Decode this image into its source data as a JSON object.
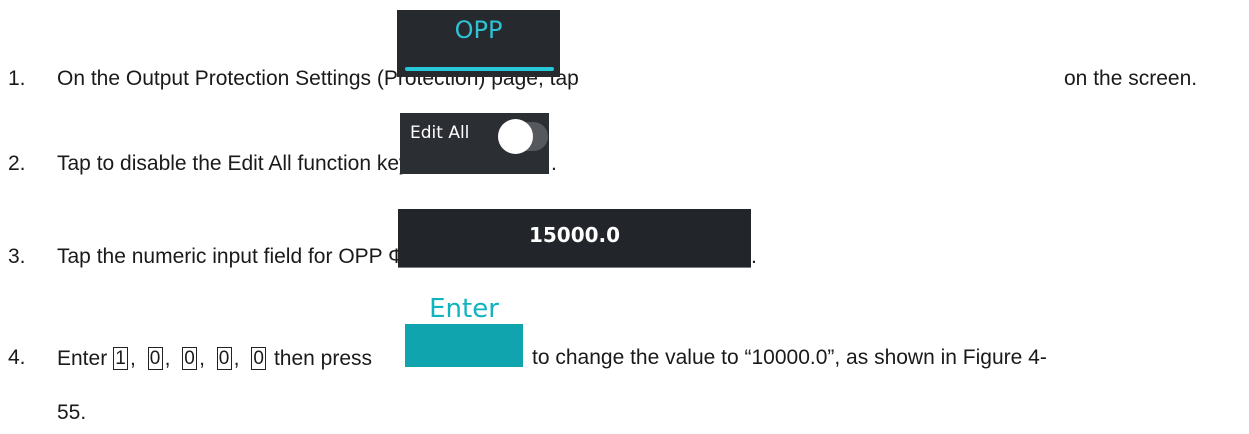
{
  "steps": [
    {
      "num": "1.",
      "before": "On the Output Protection Settings (Protection) page, tap",
      "after": "on the screen."
    },
    {
      "num": "2.",
      "before": "Tap to disable the Edit All function key",
      "after": "."
    },
    {
      "num": "3.",
      "before": "Tap the numeric input field for OPP Φ1",
      "after": "."
    },
    {
      "num": "4.",
      "before": "Enter",
      "keys": [
        "1",
        "0",
        "0",
        "0",
        "0"
      ],
      "key_sep": ",",
      "middle": "then press",
      "after": "to change the value to “10000.0”, as shown in Figure 4-",
      "continuation": "55."
    }
  ],
  "images": {
    "opp_tab": {
      "label": "OPP",
      "bg": "#262a2e",
      "accent": "#27c7d9"
    },
    "edit_all": {
      "label": "Edit All",
      "bg": "#2b2e33"
    },
    "numeric_field": {
      "value": "15000.0",
      "bg": "#22252a"
    },
    "enter_key": {
      "label": "Enter",
      "color": "#10a4af"
    }
  }
}
